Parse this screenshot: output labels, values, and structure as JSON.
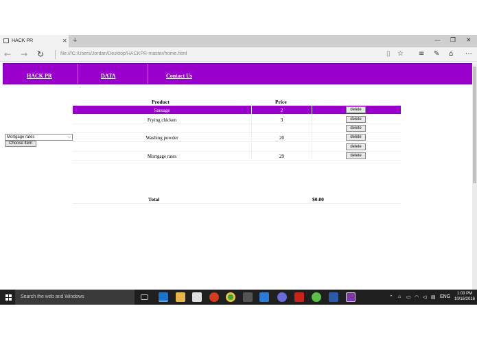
{
  "browser": {
    "tab_title": "HACK PR",
    "tab_close": "✕",
    "new_tab": "+",
    "address": "file:///C:/Users/Jordan/Desktop/HACKPR-master/home.html",
    "window_controls": [
      "—",
      "❐",
      "✕"
    ]
  },
  "site_nav": {
    "links": [
      "HACK PR",
      "DATA",
      "Contact Us"
    ],
    "color": "#9a00cc"
  },
  "sidebar": {
    "select_value": "Mortgage rates",
    "choose_button": "Choose Item"
  },
  "table": {
    "headers": {
      "product": "Product",
      "price": "Price"
    },
    "rows": [
      {
        "product": "Sausage",
        "price": "2",
        "action": "delete",
        "selected": true
      },
      {
        "product": "Frying chicken",
        "price": "3",
        "action": "delete"
      },
      {
        "product": "",
        "price": "",
        "action": "delete"
      },
      {
        "product": "Washing powder",
        "price": "20",
        "action": "delete"
      },
      {
        "product": "",
        "price": "",
        "action": "delete"
      },
      {
        "product": "Mortgage rates",
        "price": "29",
        "action": "delete"
      }
    ],
    "total_label": "Total",
    "total_value": "$0.00"
  },
  "taskbar": {
    "search_placeholder": "Search the web and Windows",
    "language": "ENG",
    "time": "1:03 PM",
    "date": "10/16/2016"
  }
}
